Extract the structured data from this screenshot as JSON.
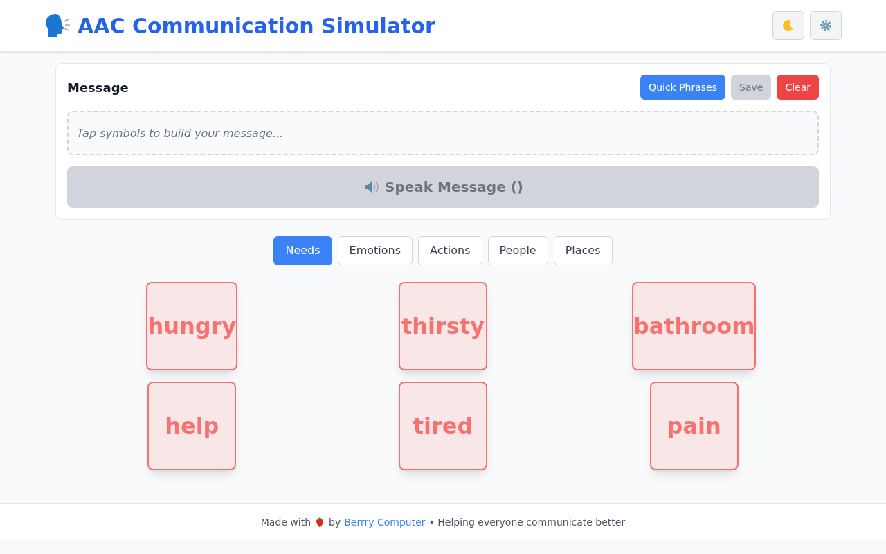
{
  "header": {
    "title": "AAC Communication Simulator",
    "buttons": [
      {
        "kind": "theme"
      },
      {
        "kind": "settings"
      }
    ]
  },
  "message": {
    "title": "Message",
    "buttons": [
      {
        "label": "Quick Phrases",
        "kind": "primary",
        "disabled": false
      },
      {
        "label": "Save",
        "disabled": true
      },
      {
        "label": "Clear",
        "kind": "danger",
        "disabled": false
      }
    ],
    "placeholder": "Tap symbols to build your message...",
    "speak": {
      "label": "Speak Message ()",
      "disabled": true
    }
  },
  "tabs": [
    {
      "label": "Needs",
      "selected": true
    },
    {
      "label": "Emotions",
      "selected": false
    },
    {
      "label": "Actions",
      "selected": false
    },
    {
      "label": "People",
      "selected": false
    },
    {
      "label": "Places",
      "selected": false
    }
  ],
  "symbols": [
    {
      "label": "hungry",
      "color": "#f87171"
    },
    {
      "label": "thirsty",
      "color": "#f87171"
    },
    {
      "label": "bathroom",
      "color": "#f87171"
    },
    {
      "label": "help",
      "color": "#f87171"
    },
    {
      "label": "tired",
      "color": "#f87171"
    },
    {
      "label": "pain",
      "color": "#f87171"
    }
  ],
  "footer": {
    "before": "Made with",
    "by": "by",
    "link": "Berrry Computer",
    "after": "• Helping everyone communicate better"
  }
}
